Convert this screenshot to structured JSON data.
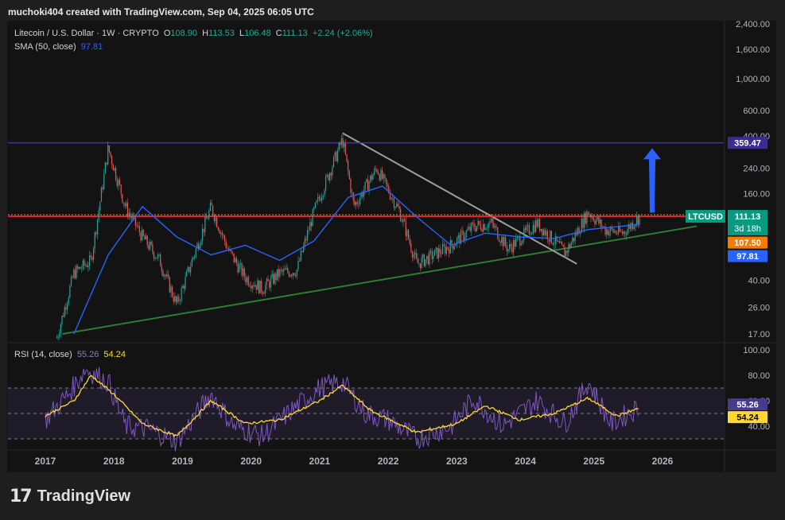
{
  "header": "muchoki404 created with TradingView.com, Sep 04, 2025 06:05 UTC",
  "legend": {
    "symbol": "Litecoin / U.S. Dollar · 1W · CRYPTO",
    "o_label": "O",
    "o_value": "108.90",
    "h_label": "H",
    "h_value": "113.53",
    "l_label": "L",
    "l_value": "106.48",
    "c_label": "C",
    "c_value": "111.13",
    "change": "+2.24 (+2.06%)",
    "sma_label": "SMA (50, close)",
    "sma_value": "97.81",
    "rsi_label": "RSI (14, close)",
    "rsi_value": "55.26",
    "rsi_ma_value": "54.24"
  },
  "badges": {
    "resistance": "359.47",
    "symbol": "LTCUSD",
    "price": "111.13",
    "countdown": "3d 18h",
    "support": "107.50",
    "sma": "97.81",
    "rsi": "55.26",
    "rsi_ma": "54.24"
  },
  "logo": {
    "mark": "17",
    "word": "TradingView"
  },
  "colors": {
    "up": "#26a69a",
    "down": "#ef5350",
    "sma": "#2962ff",
    "rsi": "#7e57c2",
    "rsi_ma": "#fdd835",
    "resistance": "#3f2fbf",
    "support_line": "#f23645",
    "trendline_up": "#2e7d32",
    "trendline_down": "#9e9e9e",
    "arrow": "#2962ff"
  },
  "chart_data": {
    "type": "candlestick",
    "x_ticks": [
      "2017",
      "2018",
      "2019",
      "2020",
      "2021",
      "2022",
      "2023",
      "2024",
      "2025",
      "2026"
    ],
    "y_ticks": [
      "2,400.00",
      "1,600.00",
      "1,000.00",
      "600.00",
      "400.00",
      "240.00",
      "160.00",
      "40.00",
      "26.00",
      "17.00"
    ],
    "y_scale": "log",
    "price_series": [
      {
        "t": "2017-03",
        "p": 16
      },
      {
        "t": "2017-06",
        "p": 45
      },
      {
        "t": "2017-09",
        "p": 55
      },
      {
        "t": "2017-12",
        "p": 330
      },
      {
        "t": "2018-03",
        "p": 130
      },
      {
        "t": "2018-06",
        "p": 80
      },
      {
        "t": "2018-09",
        "p": 55
      },
      {
        "t": "2018-12",
        "p": 27
      },
      {
        "t": "2019-03",
        "p": 60
      },
      {
        "t": "2019-06",
        "p": 130
      },
      {
        "t": "2019-09",
        "p": 65
      },
      {
        "t": "2019-12",
        "p": 42
      },
      {
        "t": "2020-03",
        "p": 35
      },
      {
        "t": "2020-06",
        "p": 45
      },
      {
        "t": "2020-09",
        "p": 47
      },
      {
        "t": "2020-12",
        "p": 120
      },
      {
        "t": "2021-05",
        "p": 380
      },
      {
        "t": "2021-07",
        "p": 130
      },
      {
        "t": "2021-11",
        "p": 240
      },
      {
        "t": "2022-03",
        "p": 120
      },
      {
        "t": "2022-06",
        "p": 52
      },
      {
        "t": "2022-12",
        "p": 70
      },
      {
        "t": "2023-04",
        "p": 95
      },
      {
        "t": "2023-07",
        "p": 100
      },
      {
        "t": "2023-10",
        "p": 66
      },
      {
        "t": "2024-03",
        "p": 100
      },
      {
        "t": "2024-08",
        "p": 62
      },
      {
        "t": "2024-12",
        "p": 120
      },
      {
        "t": "2025-03",
        "p": 90
      },
      {
        "t": "2025-06",
        "p": 85
      },
      {
        "t": "2025-09",
        "p": 111.13
      }
    ],
    "sma_series": [
      {
        "t": "2017-06",
        "p": 17
      },
      {
        "t": "2017-12",
        "p": 60
      },
      {
        "t": "2018-06",
        "p": 130
      },
      {
        "t": "2018-12",
        "p": 80
      },
      {
        "t": "2019-06",
        "p": 60
      },
      {
        "t": "2019-12",
        "p": 70
      },
      {
        "t": "2020-06",
        "p": 55
      },
      {
        "t": "2020-12",
        "p": 75
      },
      {
        "t": "2021-06",
        "p": 150
      },
      {
        "t": "2021-12",
        "p": 180
      },
      {
        "t": "2022-06",
        "p": 110
      },
      {
        "t": "2022-12",
        "p": 70
      },
      {
        "t": "2023-06",
        "p": 85
      },
      {
        "t": "2023-12",
        "p": 80
      },
      {
        "t": "2024-06",
        "p": 78
      },
      {
        "t": "2024-12",
        "p": 90
      },
      {
        "t": "2025-06",
        "p": 95
      },
      {
        "t": "2025-09",
        "p": 97.81
      }
    ],
    "resistance_level": 359.47,
    "horizontal_level": 111.13,
    "rising_trendline": [
      {
        "t": "2017-04",
        "p": 17
      },
      {
        "t": "2026-07",
        "p": 95
      }
    ],
    "falling_trendline": [
      {
        "t": "2021-05",
        "p": 420
      },
      {
        "t": "2024-10",
        "p": 52
      }
    ],
    "rsi_ticks": [
      "100.00",
      "80.00",
      "60.00",
      "40.00"
    ],
    "rsi_levels": [
      70,
      50,
      30
    ],
    "rsi_series": [
      {
        "t": "2017-01",
        "v": 45
      },
      {
        "t": "2017-05",
        "v": 65
      },
      {
        "t": "2017-08",
        "v": 85
      },
      {
        "t": "2017-12",
        "v": 75
      },
      {
        "t": "2018-03",
        "v": 40
      },
      {
        "t": "2018-07",
        "v": 38
      },
      {
        "t": "2018-12",
        "v": 28
      },
      {
        "t": "2019-06",
        "v": 65
      },
      {
        "t": "2019-10",
        "v": 40
      },
      {
        "t": "2020-03",
        "v": 32
      },
      {
        "t": "2020-08",
        "v": 52
      },
      {
        "t": "2021-01",
        "v": 70
      },
      {
        "t": "2021-05",
        "v": 75
      },
      {
        "t": "2021-09",
        "v": 50
      },
      {
        "t": "2022-01",
        "v": 45
      },
      {
        "t": "2022-06",
        "v": 30
      },
      {
        "t": "2022-12",
        "v": 40
      },
      {
        "t": "2023-04",
        "v": 62
      },
      {
        "t": "2023-09",
        "v": 40
      },
      {
        "t": "2024-03",
        "v": 60
      },
      {
        "t": "2024-08",
        "v": 42
      },
      {
        "t": "2024-12",
        "v": 75
      },
      {
        "t": "2025-04",
        "v": 42
      },
      {
        "t": "2025-09",
        "v": 55.26
      }
    ],
    "rsi_ma_series": [
      {
        "t": "2017-01",
        "v": 48
      },
      {
        "t": "2017-06",
        "v": 60
      },
      {
        "t": "2017-09",
        "v": 80
      },
      {
        "t": "2018-01",
        "v": 65
      },
      {
        "t": "2018-06",
        "v": 42
      },
      {
        "t": "2018-12",
        "v": 32
      },
      {
        "t": "2019-06",
        "v": 60
      },
      {
        "t": "2019-12",
        "v": 42
      },
      {
        "t": "2020-06",
        "v": 45
      },
      {
        "t": "2021-01",
        "v": 60
      },
      {
        "t": "2021-05",
        "v": 72
      },
      {
        "t": "2021-10",
        "v": 52
      },
      {
        "t": "2022-06",
        "v": 35
      },
      {
        "t": "2023-01",
        "v": 42
      },
      {
        "t": "2023-06",
        "v": 56
      },
      {
        "t": "2023-12",
        "v": 45
      },
      {
        "t": "2024-06",
        "v": 50
      },
      {
        "t": "2024-12",
        "v": 62
      },
      {
        "t": "2025-05",
        "v": 48
      },
      {
        "t": "2025-09",
        "v": 54.24
      }
    ]
  }
}
